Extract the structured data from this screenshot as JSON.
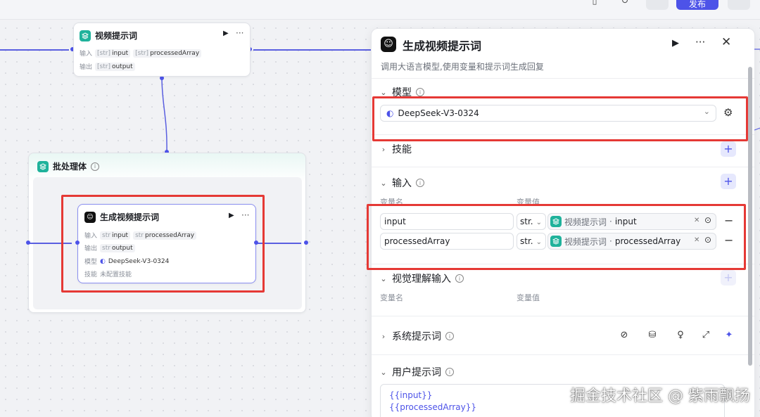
{
  "topbar": {
    "publish_label": "发布",
    "publish_color": "#4d53e8"
  },
  "canvas": {
    "node_video_prompt": {
      "title": "视频提示词",
      "input_label": "输入",
      "output_label": "输出",
      "inputs": [
        {
          "type": "[str]",
          "name": "input"
        },
        {
          "type": "[str]",
          "name": "processedArray"
        }
      ],
      "outputs": [
        {
          "type": "[str]",
          "name": "output"
        }
      ]
    },
    "batch_body": {
      "title": "批处理体"
    },
    "node_gen": {
      "title": "生成视频提示词",
      "input_label": "输入",
      "output_label": "输出",
      "model_label": "模型",
      "skill_label": "技能",
      "inputs": [
        {
          "type": "str",
          "name": "input"
        },
        {
          "type": "str",
          "name": "processedArray"
        }
      ],
      "outputs": [
        {
          "type": "str",
          "name": "output"
        }
      ],
      "model": "DeepSeek-V3-0324",
      "skill_value": "未配置技能"
    }
  },
  "panel": {
    "title": "生成视频提示词",
    "subtitle": "调用大语言模型,使用变量和提示词生成回复",
    "model_section": {
      "label": "模型",
      "selected": "DeepSeek-V3-0324"
    },
    "skill_section": {
      "label": "技能"
    },
    "input_section": {
      "label": "输入",
      "col_name": "变量名",
      "col_value": "变量值",
      "rows": [
        {
          "name": "input",
          "type": "str.",
          "source": "视频提示词",
          "var": "input"
        },
        {
          "name": "processedArray",
          "type": "str.",
          "source": "视频提示词",
          "var": "processedArray"
        }
      ]
    },
    "vision_section": {
      "label": "视觉理解输入",
      "col_name": "变量名",
      "col_value": "变量值"
    },
    "system_prompt": {
      "label": "系统提示词"
    },
    "user_prompt": {
      "label": "用户提示词",
      "line1": "{{input}}",
      "line2": "{{processedArray}}"
    }
  },
  "watermark": "掘金技术社区 @ 紫雨飘扬",
  "colors": {
    "accent": "#4d53e8",
    "highlight": "#e53935",
    "teal": "#1fb29b"
  }
}
